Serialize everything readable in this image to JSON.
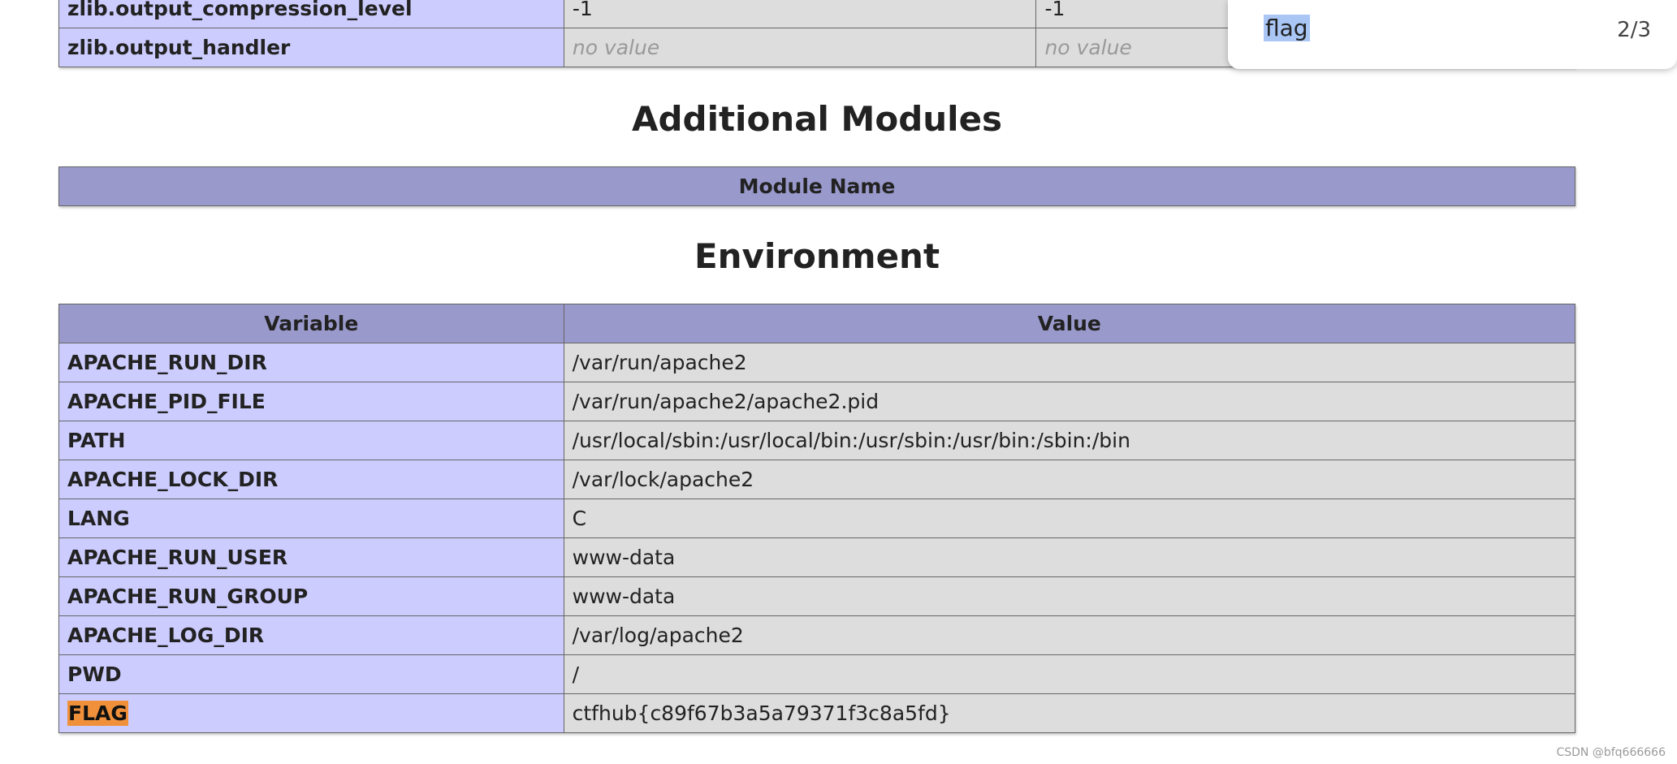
{
  "zlib_table": {
    "rows": [
      {
        "directive": "zlib.output_compression_level",
        "local": "-1",
        "master": "-1",
        "no_value": false
      },
      {
        "directive": "zlib.output_handler",
        "local": "no value",
        "master": "no value",
        "no_value": true
      }
    ]
  },
  "additional_modules": {
    "title": "Additional Modules",
    "header": "Module Name"
  },
  "environment": {
    "title": "Environment",
    "headers": {
      "variable": "Variable",
      "value": "Value"
    },
    "rows": [
      {
        "name": "APACHE_RUN_DIR",
        "value": "/var/run/apache2"
      },
      {
        "name": "APACHE_PID_FILE",
        "value": "/var/run/apache2/apache2.pid"
      },
      {
        "name": "PATH",
        "value": "/usr/local/sbin:/usr/local/bin:/usr/sbin:/usr/bin:/sbin:/bin"
      },
      {
        "name": "APACHE_LOCK_DIR",
        "value": "/var/lock/apache2"
      },
      {
        "name": "LANG",
        "value": "C"
      },
      {
        "name": "APACHE_RUN_USER",
        "value": "www-data"
      },
      {
        "name": "APACHE_RUN_GROUP",
        "value": "www-data"
      },
      {
        "name": "APACHE_LOG_DIR",
        "value": "/var/log/apache2"
      },
      {
        "name": "PWD",
        "value": "/"
      },
      {
        "name": "FLAG",
        "value": "ctfhub{c89f67b3a5a79371f3c8a5fd}",
        "highlight": true
      }
    ]
  },
  "find_bar": {
    "query": "flag",
    "count": "2/3"
  },
  "watermark": "CSDN @bfq666666",
  "colors": {
    "row_label_bg": "#ccccff",
    "value_bg": "#dddddd",
    "header_bg": "#9999cc",
    "find_match_active": "#f0903a",
    "find_selection": "#a9c6f5"
  }
}
